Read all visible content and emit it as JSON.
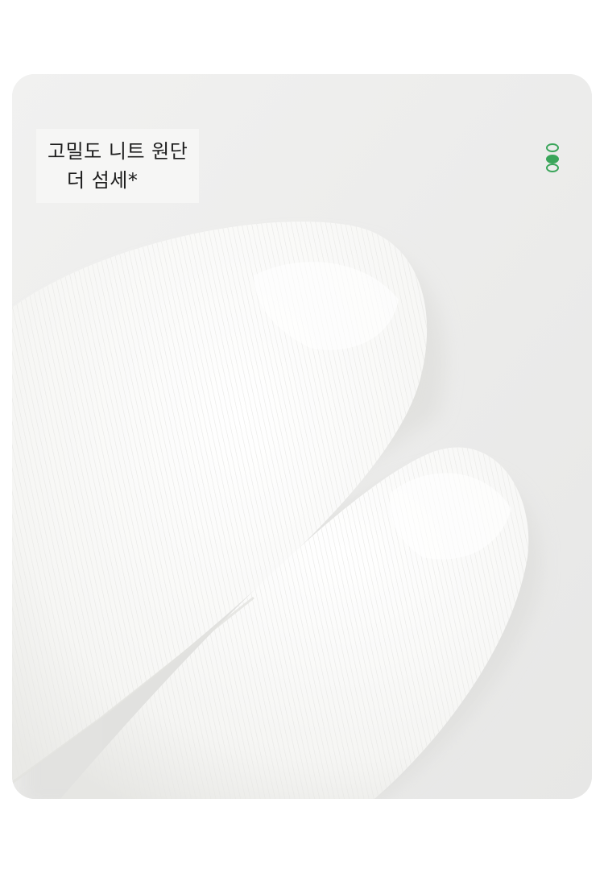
{
  "caption": {
    "line1": "고밀도 니트 원단",
    "line2": "더 섬세*"
  },
  "indicator": {
    "icon": "pagination-dots-icon",
    "accent_color": "#3aa55a"
  },
  "photo": {
    "subject": "white-socks-toe-closeup-icon"
  }
}
